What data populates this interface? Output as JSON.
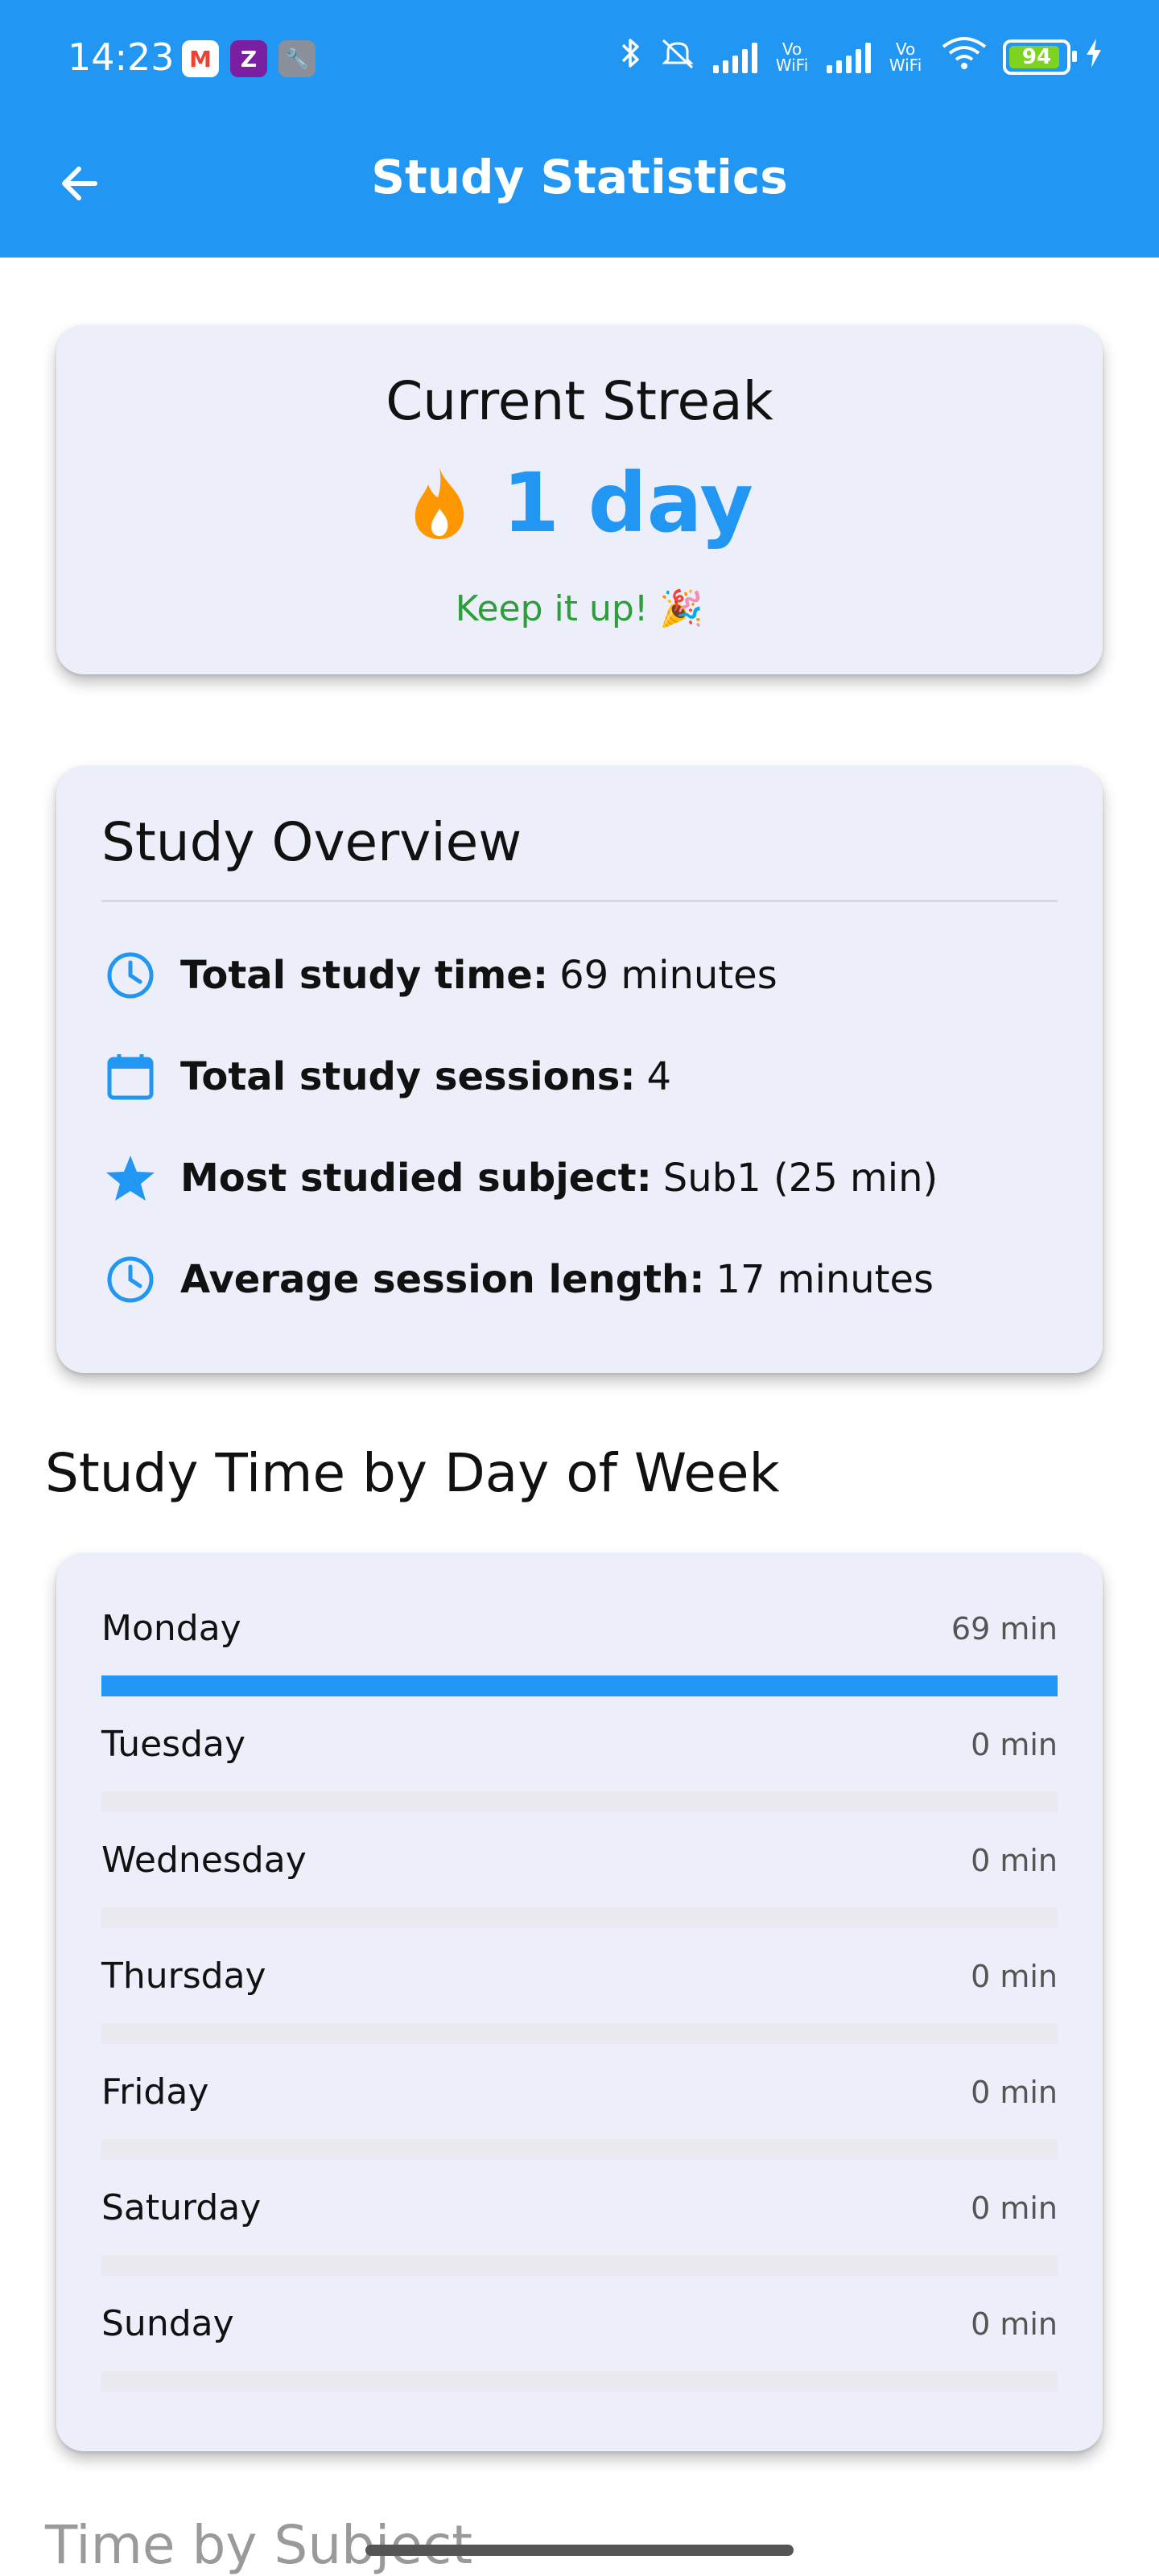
{
  "status_bar": {
    "time": "14:23",
    "apps": [
      {
        "icon": "gmail-icon",
        "glyph": "M",
        "color": "#ea4335",
        "bg": "#ffffff"
      },
      {
        "icon": "zee-icon",
        "glyph": "Z",
        "color": "#ffffff",
        "bg": "#7b1fa2"
      },
      {
        "icon": "wrench-icon",
        "glyph": "🔧",
        "color": "#ffffff",
        "bg": "#8a8f99"
      }
    ],
    "vowifi_1": "Vo WiFi",
    "vowifi_2": "Vo WiFi",
    "battery": "94"
  },
  "appbar": {
    "title": "Study Statistics",
    "back_icon": "arrow-left-icon"
  },
  "streak": {
    "title": "Current Streak",
    "value": "1 day",
    "note": "Keep it up! 🎉",
    "icon": "flame-icon",
    "flame_color": "#ff9800"
  },
  "overview": {
    "title": "Study Overview",
    "rows": [
      {
        "icon": "clock-icon",
        "label": "Total study time:",
        "value": "69 minutes"
      },
      {
        "icon": "calendar-icon",
        "label": "Total study sessions:",
        "value": "4"
      },
      {
        "icon": "star-icon",
        "label": "Most studied subject:",
        "value": "Sub1 (25 min)"
      },
      {
        "icon": "clock-icon",
        "label": "Average session length:",
        "value": "17 minutes"
      }
    ]
  },
  "weekly": {
    "title": "Study Time by Day of Week",
    "max_minutes": 69,
    "days": [
      {
        "name": "Monday",
        "minutes_label": "69 min",
        "minutes": 69
      },
      {
        "name": "Tuesday",
        "minutes_label": "0 min",
        "minutes": 0
      },
      {
        "name": "Wednesday",
        "minutes_label": "0 min",
        "minutes": 0
      },
      {
        "name": "Thursday",
        "minutes_label": "0 min",
        "minutes": 0
      },
      {
        "name": "Friday",
        "minutes_label": "0 min",
        "minutes": 0
      },
      {
        "name": "Saturday",
        "minutes_label": "0 min",
        "minutes": 0
      },
      {
        "name": "Sunday",
        "minutes_label": "0 min",
        "minutes": 0
      }
    ]
  },
  "next_section": {
    "title": "Time by Subject"
  },
  "colors": {
    "primary": "#2196f3",
    "card_bg": "#eceef9",
    "success": "#2e9e3b"
  }
}
